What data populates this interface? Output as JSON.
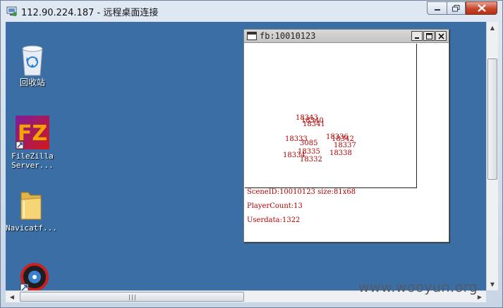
{
  "window": {
    "title": "112.90.224.187 - 远程桌面连接",
    "icon": "remote-desktop-icon",
    "close_color": "#c8452c"
  },
  "desktop": {
    "background_color": "#3a6ea5",
    "icons": [
      {
        "label": "回收站",
        "icon": "recycle-bin-icon"
      },
      {
        "label_line1": "FileZilla",
        "label_line2": "Server...",
        "icon": "filezilla-icon"
      },
      {
        "label": "Navicatf...",
        "icon": "folder-icon"
      },
      {
        "label": "",
        "icon": "app-shortcut-icon"
      }
    ]
  },
  "fb_window": {
    "title": "fb:10010123",
    "players": [
      {
        "id": "18343"
      },
      {
        "id": "18340"
      },
      {
        "id": "18341"
      },
      {
        "id": "18336"
      },
      {
        "id": "18342"
      },
      {
        "id": "18333"
      },
      {
        "id": "3085"
      },
      {
        "id": "18337"
      },
      {
        "id": "18335"
      },
      {
        "id": "18334"
      },
      {
        "id": "18338"
      },
      {
        "id": "18332"
      }
    ],
    "scene_line": "SceneID:10010123 size:81x68",
    "player_count_line": "PlayerCount:13",
    "userdata_line": "Userdata:1322",
    "text_color": "#b00000"
  },
  "watermark": "www.wooyun.org"
}
